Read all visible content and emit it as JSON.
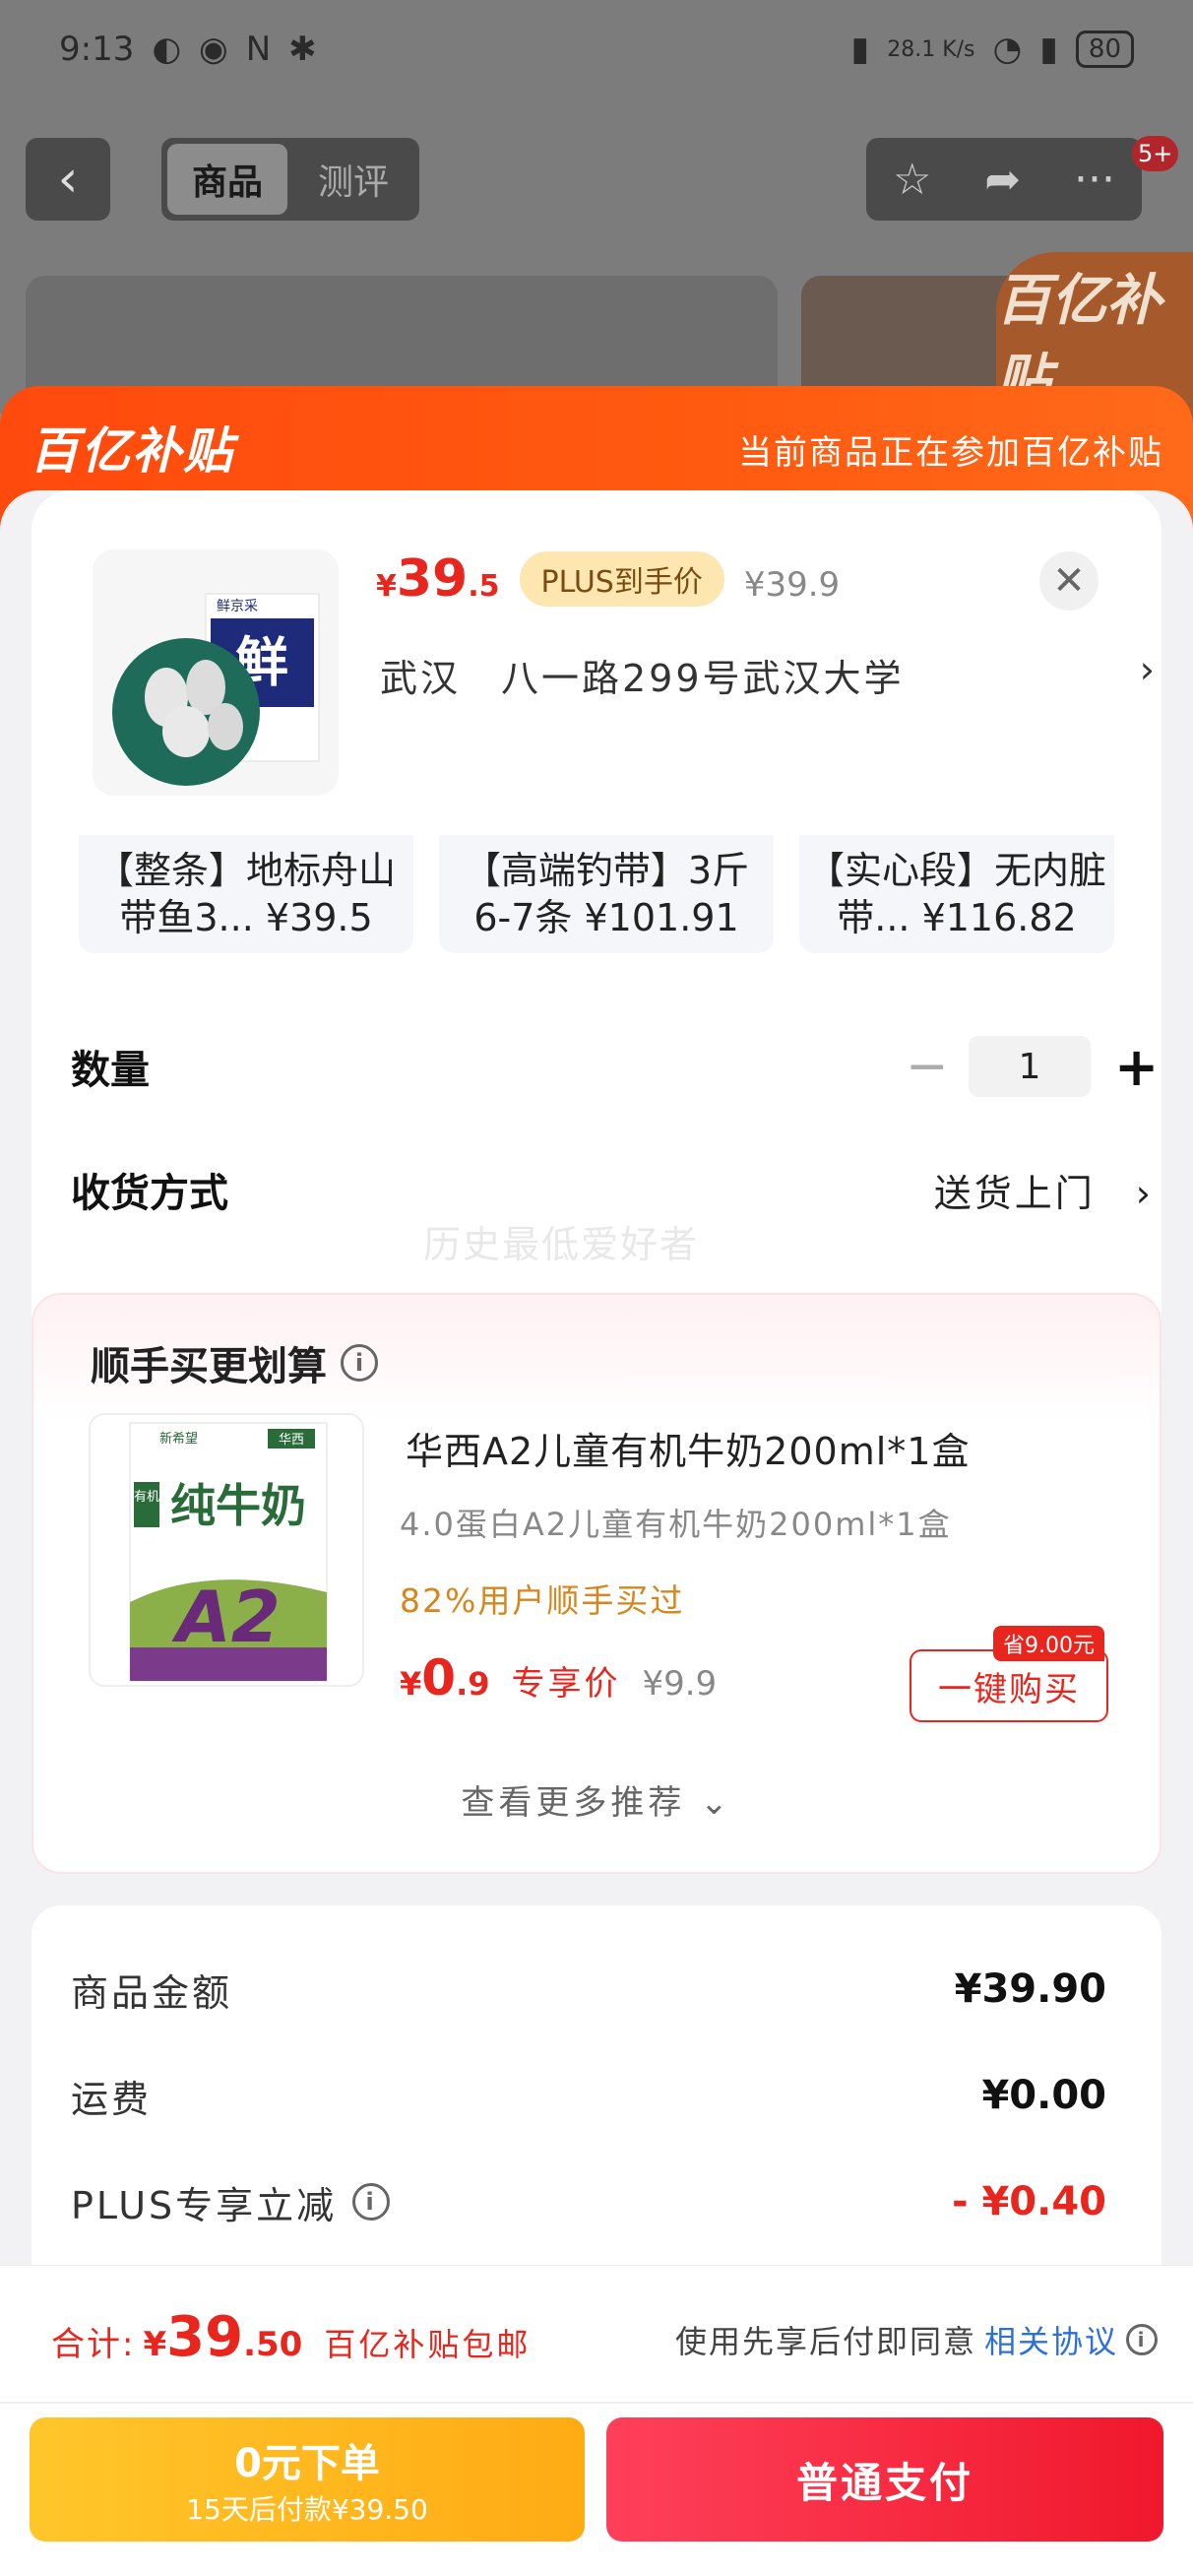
{
  "status_bar": {
    "time": "9:13",
    "network_speed": "28.1 K/s",
    "battery": "80"
  },
  "nav": {
    "back_icon": "chevron-left-icon",
    "tabs": [
      {
        "label": "商品",
        "active": true
      },
      {
        "label": "测评",
        "active": false
      }
    ],
    "badge": "5+"
  },
  "background": {
    "brand_logo": "百亿补贴"
  },
  "sheet_header": {
    "logo": "百亿补贴",
    "note": "当前商品正在参加百亿补贴"
  },
  "product": {
    "price_symbol": "¥",
    "price_int": "39",
    "price_dec": ".5",
    "plus_tag": "PLUS到手价",
    "original_price": "¥39.9",
    "address": "武汉　八一路299号武汉大学",
    "thumb_brand": "鲜京采",
    "thumb_big_text": "鲜"
  },
  "variants": [
    {
      "line1": "【整条】地标舟山",
      "line2": "带鱼3... ¥39.5"
    },
    {
      "line1": "【高端钓带】3斤",
      "line2": "6-7条 ¥101.91"
    },
    {
      "line1": "【实心段】无内脏",
      "line2": "带... ¥116.82"
    }
  ],
  "quantity": {
    "label": "数量",
    "minus": "−",
    "value": "1",
    "plus": "+"
  },
  "shipping": {
    "label": "收货方式",
    "value": "送货上门"
  },
  "watermark": "历史最低爱好者",
  "recommend": {
    "title": "顺手买更划算",
    "name": "华西A2儿童有机牛奶200ml*1盒",
    "sub": "4.0蛋白A2儿童有机牛奶200ml*1盒",
    "social": "82%用户顺手买过",
    "price_symbol": "¥",
    "price_int": "0",
    "price_dec": ".9",
    "price_tag": "专享价",
    "original_price": "¥9.9",
    "save_badge": "省9.00元",
    "buy_label": "一键购买",
    "more": "查看更多推荐",
    "img_brand_left": "新希望",
    "img_brand_right": "华西",
    "img_title": "纯牛奶",
    "img_prefix": "有机",
    "img_mark": "A2"
  },
  "breakdown": [
    {
      "label": "商品金额",
      "value": "¥39.90",
      "info": false,
      "red": false
    },
    {
      "label": "运费",
      "value": "¥0.00",
      "info": false,
      "red": false
    },
    {
      "label": "PLUS专享立减",
      "value": "- ¥0.40",
      "info": true,
      "red": true
    }
  ],
  "bottom": {
    "total_label": "合计:",
    "total_symbol": "¥",
    "total_int": "39",
    "total_dec": ".50",
    "total_note": "百亿补贴包邮",
    "agree_text": "使用先享后付即同意",
    "agree_link": "相关协议",
    "bnpl_title": "0元下单",
    "bnpl_sub": "15天后付款¥39.50",
    "pay_label": "普通支付"
  },
  "colors": {
    "accent_red": "#e8261e",
    "brand_orange": "#ff4a0e",
    "bnpl_yellow": "#ffb81c",
    "link_blue": "#2e6fd8"
  }
}
